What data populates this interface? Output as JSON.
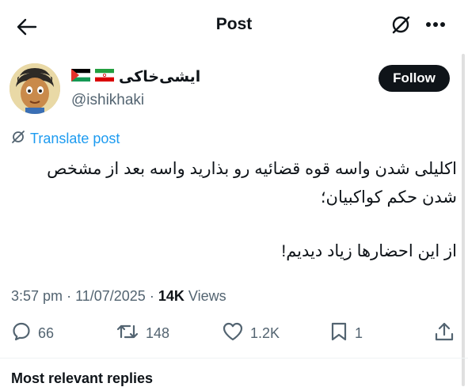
{
  "header": {
    "title": "Post"
  },
  "author": {
    "display_name": "ایشی‌خاکی",
    "handle": "@ishikhaki",
    "follow_label": "Follow"
  },
  "translate_label": "Translate post",
  "post": {
    "line1": "اکلیلی شدن واسه قوه قضائیه رو بذارید واسه بعد از مشخص شدن حکم کواکبیان؛",
    "line2": "از این احضارها زیاد دیدیم!"
  },
  "meta": {
    "time": "3:57 pm",
    "date": "11/07/2025",
    "views_count": "14K",
    "views_label": "Views"
  },
  "actions": {
    "replies": "66",
    "reposts": "148",
    "likes": "1.2K",
    "bookmarks": "1"
  },
  "section_label": "Most relevant replies",
  "colors": {
    "link": "#1d9bf0",
    "text": "#0f1419",
    "muted": "#536471"
  }
}
